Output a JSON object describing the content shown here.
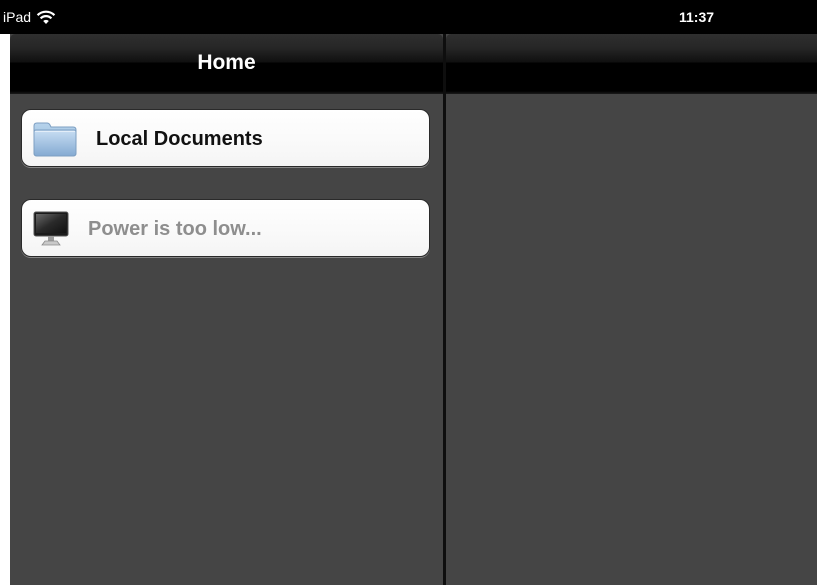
{
  "status_bar": {
    "device": "iPad",
    "wifi_icon": "wifi-icon",
    "time": "11:37"
  },
  "master": {
    "title": "Home",
    "items": [
      {
        "label": "Local Documents",
        "icon": "folder-icon",
        "dimmed": false
      },
      {
        "label": "Power is too low...",
        "icon": "monitor-icon",
        "dimmed": true
      }
    ]
  },
  "detail": {
    "title": ""
  },
  "colors": {
    "pane_background": "#454545",
    "navbar": "#000000",
    "cell_background": "#ffffff",
    "cell_text": "#111111",
    "dimmed_text": "#8e8e8e"
  }
}
